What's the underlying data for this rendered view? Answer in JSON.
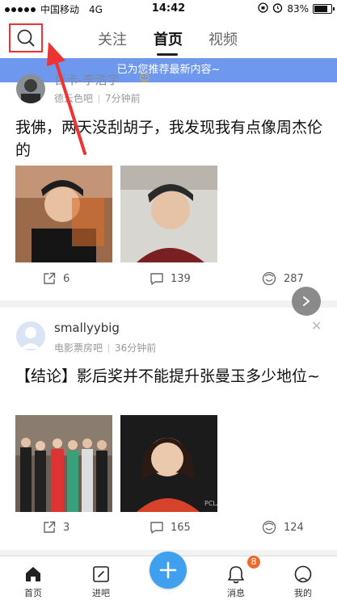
{
  "status_bar": {
    "carrier": "中国移动",
    "network": "4G",
    "time": "14:42",
    "battery": "83%"
  },
  "nav": {
    "tabs": [
      {
        "label": "关注",
        "active": false
      },
      {
        "label": "首页",
        "active": true
      },
      {
        "label": "视频",
        "active": false
      }
    ]
  },
  "banner": {
    "text": "已为您推荐最新内容~"
  },
  "posts": [
    {
      "username": "百卡-李浩宇",
      "bar": "德云色吧",
      "time": "7分钟前",
      "title": "我佛，两天没刮胡子，我发现我有点像周杰伦的",
      "shares": "6",
      "comments": "139",
      "likes": "287"
    },
    {
      "username": "smallyybig",
      "bar": "电影票房吧",
      "time": "36分钟前",
      "title": "【结论】影后奖并不能提升张曼玉多少地位~",
      "shares": "3",
      "comments": "165",
      "likes": "124"
    }
  ],
  "bottom_nav": {
    "home": "首页",
    "enter_bar": "进吧",
    "messages": "消息",
    "messages_badge": "8",
    "mine": "我的"
  },
  "colors": {
    "accent_blue": "#3fa0ee",
    "banner_blue": "#6e98ee",
    "highlight_red": "#e33333",
    "badge_orange": "#ef6a2e"
  },
  "icons": [
    "search-icon",
    "share-icon",
    "comment-icon",
    "like-icon",
    "next-arrow-icon",
    "home-icon",
    "enter-bar-icon",
    "plus-icon",
    "bell-icon",
    "profile-icon",
    "close-icon"
  ]
}
